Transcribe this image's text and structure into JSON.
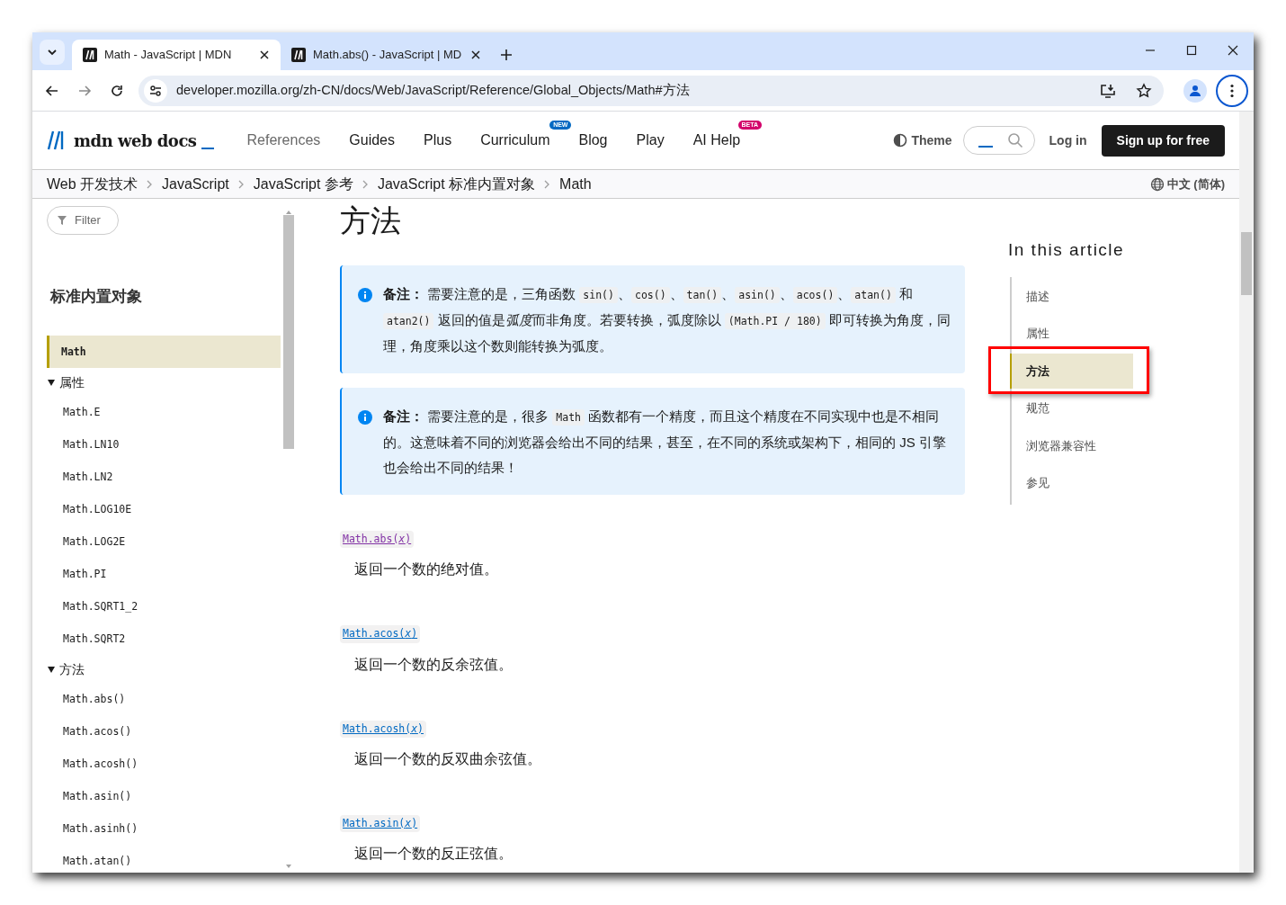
{
  "browser": {
    "tabs": [
      {
        "title": "Math - JavaScript | MDN",
        "selected": true
      },
      {
        "title": "Math.abs() - JavaScript | MD",
        "selected": false
      }
    ],
    "address": "developer.mozilla.org/zh-CN/docs/Web/JavaScript/Reference/Global_Objects/Math#方法"
  },
  "site_header": {
    "logo": "mdn web docs",
    "nav": [
      {
        "label": "References",
        "dimmed": true
      },
      {
        "label": "Guides",
        "dimmed": false
      },
      {
        "label": "Plus",
        "dimmed": false
      },
      {
        "label": "Curriculum",
        "dimmed": false,
        "badge": {
          "text": "NEW",
          "color": "#0069c2"
        }
      },
      {
        "label": "Blog",
        "dimmed": false
      },
      {
        "label": "Play",
        "dimmed": false
      },
      {
        "label": "AI Help",
        "dimmed": false,
        "badge": {
          "text": "BETA",
          "color": "#d3006b"
        }
      }
    ],
    "theme": "Theme",
    "login": "Log in",
    "signup": "Sign up for free"
  },
  "breadcrumbs": [
    "Web 开发技术",
    "JavaScript",
    "JavaScript 参考",
    "JavaScript 标准内置对象",
    "Math"
  ],
  "language": "中文 (简体)",
  "sidebar": {
    "filter": {
      "placeholder": "Filter"
    },
    "title": "标准内置对象",
    "items": [
      {
        "label": "Math",
        "selected": true
      }
    ],
    "groups": [
      {
        "label": "属性",
        "expanded": true,
        "items": [
          {
            "label": "Math.E",
            "selected": false
          },
          {
            "label": "Math.LN10",
            "selected": false
          },
          {
            "label": "Math.LN2",
            "selected": false
          },
          {
            "label": "Math.LOG10E",
            "selected": false
          },
          {
            "label": "Math.LOG2E",
            "selected": false
          },
          {
            "label": "Math.PI",
            "selected": false
          },
          {
            "label": "Math.SQRT1_2",
            "selected": false
          },
          {
            "label": "Math.SQRT2",
            "selected": false
          }
        ]
      },
      {
        "label": "方法",
        "expanded": true,
        "items": [
          {
            "label": "Math.abs()",
            "selected": false
          },
          {
            "label": "Math.acos()",
            "selected": false
          },
          {
            "label": "Math.acosh()",
            "selected": false
          },
          {
            "label": "Math.asin()",
            "selected": false
          },
          {
            "label": "Math.asinh()",
            "selected": false
          },
          {
            "label": "Math.atan()",
            "selected": false
          }
        ]
      }
    ]
  },
  "article": {
    "heading": "方法",
    "notes": [
      {
        "parts": [
          {
            "kind": "strong",
            "text": "备注："
          },
          {
            "kind": "text",
            "text": " 需要注意的是，三角函数 "
          },
          {
            "kind": "code",
            "text": "sin()"
          },
          {
            "kind": "text",
            "text": "、"
          },
          {
            "kind": "code",
            "text": "cos()"
          },
          {
            "kind": "text",
            "text": "、"
          },
          {
            "kind": "code",
            "text": "tan()"
          },
          {
            "kind": "text",
            "text": "、"
          },
          {
            "kind": "code",
            "text": "asin()"
          },
          {
            "kind": "text",
            "text": "、"
          },
          {
            "kind": "code",
            "text": "acos()"
          },
          {
            "kind": "text",
            "text": "、"
          },
          {
            "kind": "code",
            "text": "atan()"
          },
          {
            "kind": "text",
            "text": " 和 "
          },
          {
            "kind": "code",
            "text": "atan2()"
          },
          {
            "kind": "text",
            "text": " 返回的值是"
          },
          {
            "kind": "em",
            "text": "弧度"
          },
          {
            "kind": "text",
            "text": "而非角度。若要转换，弧度除以 "
          },
          {
            "kind": "code",
            "text": "(Math.PI / 180)"
          },
          {
            "kind": "text",
            "text": " 即可转换为角度，同理，角度乘以这个数则能转换为弧度。"
          }
        ]
      },
      {
        "parts": [
          {
            "kind": "strong",
            "text": "备注："
          },
          {
            "kind": "text",
            "text": " 需要注意的是，很多 "
          },
          {
            "kind": "code",
            "text": "Math"
          },
          {
            "kind": "text",
            "text": " 函数都有一个精度，而且这个精度在不同实现中也是不相同的。这意味着不同的浏览器会给出不同的结果，甚至，在不同的系统或架构下，相同的 JS 引擎也会给出不同的结果！"
          }
        ]
      }
    ],
    "methods": [
      {
        "name": "Math.abs(*x*)",
        "summary": "返回一个数的绝对值。",
        "visited": true
      },
      {
        "name": "Math.acos(*x*)",
        "summary": "返回一个数的反余弦值。",
        "visited": false
      },
      {
        "name": "Math.acosh(*x*)",
        "summary": "返回一个数的反双曲余弦值。",
        "visited": false
      },
      {
        "name": "Math.asin(*x*)",
        "summary": "返回一个数的反正弦值。",
        "visited": false
      }
    ]
  },
  "toc": {
    "title": "In this article",
    "items": [
      {
        "label": "描述",
        "selected": false
      },
      {
        "label": "属性",
        "selected": false
      },
      {
        "label": "方法",
        "selected": true
      },
      {
        "label": "规范",
        "selected": false
      },
      {
        "label": "浏览器兼容性",
        "selected": false
      },
      {
        "label": "参见",
        "selected": false
      }
    ]
  }
}
